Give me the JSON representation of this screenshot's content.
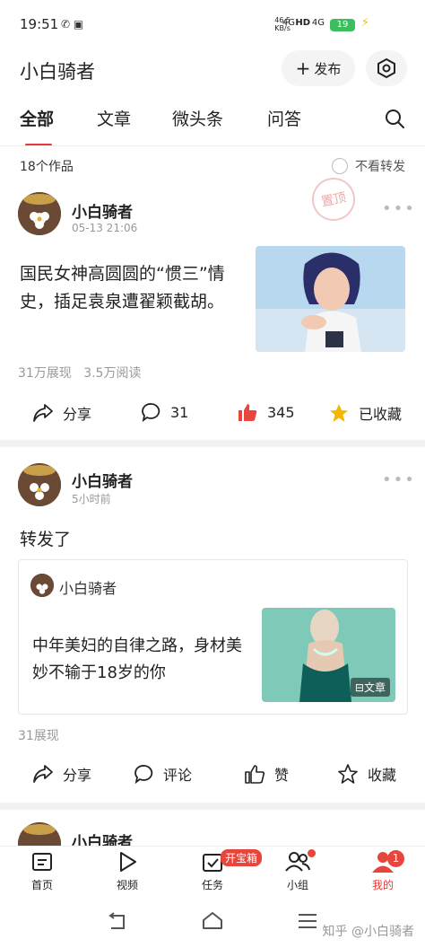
{
  "status_bar": {
    "time": "19:51",
    "net_speed": "46.5",
    "net_unit": "KB/s",
    "signal1": "4G",
    "signal2": "4G",
    "battery": "19"
  },
  "header": {
    "title": "小白骑者",
    "publish_label": "发布"
  },
  "tabs": [
    {
      "label": "全部",
      "active": true
    },
    {
      "label": "文章",
      "active": false
    },
    {
      "label": "微头条",
      "active": false
    },
    {
      "label": "问答",
      "active": false
    }
  ],
  "filter": {
    "works_count": "18个作品",
    "no_repost_label": "不看转发"
  },
  "posts": [
    {
      "author": "小白骑者",
      "time": "05-13 21:06",
      "stamp": "置顶",
      "title": "国民女神高圆圆的“惯三”情史，插足袁泉遭翟颖截胡。",
      "views": "31万展现",
      "reads": "3.5万阅读",
      "share_label": "分享",
      "comments": "31",
      "likes": "345",
      "collect_label": "已收藏"
    },
    {
      "author": "小白骑者",
      "time": "5小时前",
      "text": "转发了",
      "quoted": {
        "author": "小白骑者",
        "title": "中年美妇的自律之路，身材美妙不输于18岁的你",
        "badge": "文章"
      },
      "views": "31展现",
      "share_label": "分享",
      "comment_label": "评论",
      "like_label": "赞",
      "collect_label": "收藏"
    },
    {
      "author": "小白骑者"
    }
  ],
  "bottom_nav": [
    {
      "label": "首页",
      "icon": "home-icon"
    },
    {
      "label": "视频",
      "icon": "play-icon"
    },
    {
      "label": "任务",
      "icon": "task-icon",
      "badge": "开宝箱"
    },
    {
      "label": "小组",
      "icon": "group-icon"
    },
    {
      "label": "我的",
      "icon": "user-icon",
      "count": "1",
      "active": true
    }
  ],
  "watermark": "知乎 @小白骑者",
  "colors": {
    "accent": "#e33a3a",
    "like": "#e8453c",
    "star": "#f5b800"
  }
}
